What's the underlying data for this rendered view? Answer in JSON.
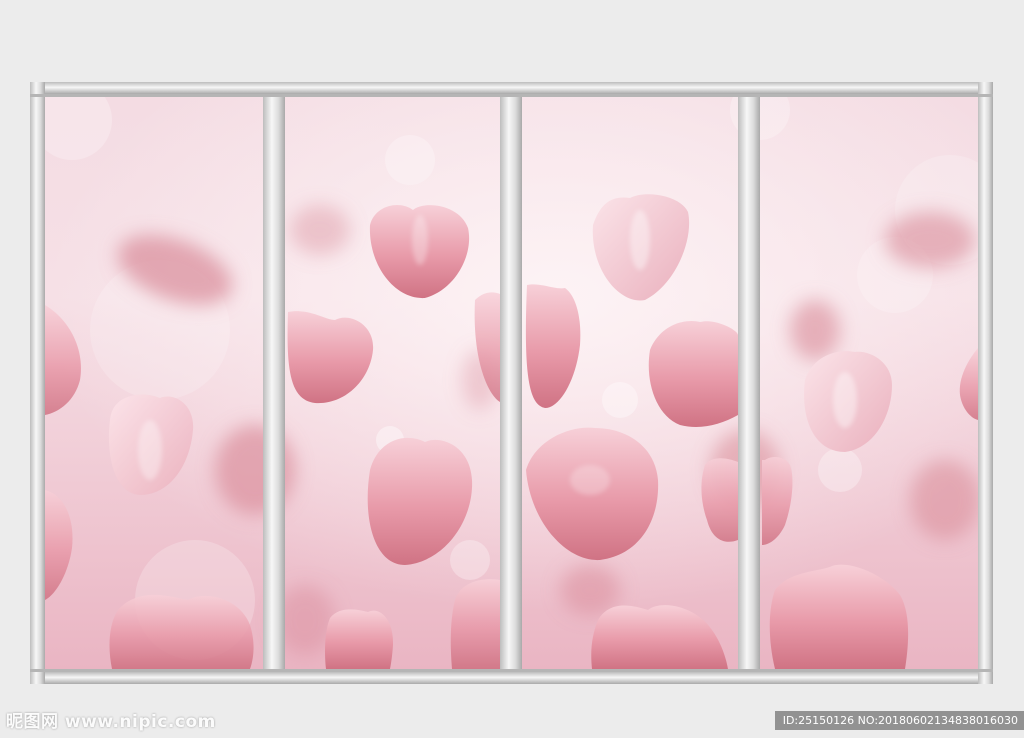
{
  "watermark": {
    "site": "昵图网 www.nipic.com",
    "id_line": "ID:25150126 NO:20180602134838016030"
  },
  "colors": {
    "background": "#ececec",
    "frame": "#c9c9c9",
    "frame_highlight": "#f6f6f6",
    "panel_light": "#fbe6ec",
    "panel_mid": "#f2c4d0",
    "petal_light": "#f7cdd6",
    "petal_dark": "#cf6d7e"
  }
}
